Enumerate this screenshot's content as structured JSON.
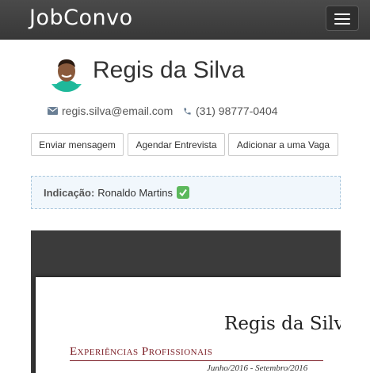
{
  "navbar": {
    "brand": "JobConvo",
    "menu_icon": "hamburger-menu-icon"
  },
  "profile": {
    "name": "Regis da Silva",
    "email": "regis.silva@email.com",
    "phone": "(31) 98777-0404",
    "email_icon": "envelope-icon",
    "phone_icon": "phone-icon"
  },
  "actions": {
    "send_message": "Enviar mensagem",
    "schedule_interview": "Agendar Entrevista",
    "add_to_job": "Adicionar a uma Vaga"
  },
  "indicacao": {
    "label": "Indicação:",
    "value": "Ronaldo Martins",
    "icon": "check-mark-icon"
  },
  "document": {
    "name": "Regis da Silva",
    "section_title": "Experiências Profissionais",
    "date_range": "Junho/2016 - Setembro/2016"
  },
  "colors": {
    "navbar": "#3f3f3f",
    "indicacao_border": "#a9c7dd",
    "indicacao_bg": "#f1f7fc",
    "check": "#5cb85c",
    "section_title": "#7b1c24",
    "viewer_bg": "#3b3b3b"
  }
}
